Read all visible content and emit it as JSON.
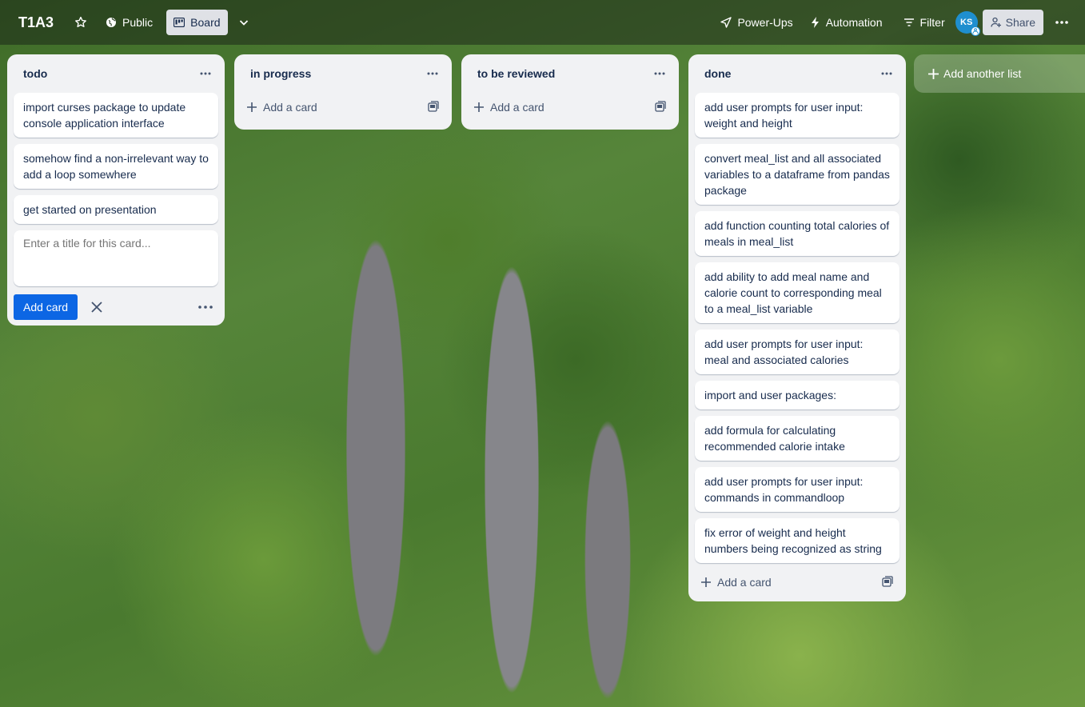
{
  "header": {
    "board_title": "T1A3",
    "visibility_label": "Public",
    "view_label": "Board",
    "powerups_label": "Power-Ups",
    "automation_label": "Automation",
    "filter_label": "Filter",
    "avatar_initials": "KS",
    "share_label": "Share"
  },
  "lists": [
    {
      "title": "todo",
      "cards": [
        "import curses package to update console application interface",
        "somehow find a non-irrelevant way to add a loop somewhere",
        "get started on presentation"
      ],
      "composer_placeholder": "Enter a title for this card...",
      "composer_button": "Add card"
    },
    {
      "title": "in progress",
      "cards": [],
      "add_card_label": "Add a card"
    },
    {
      "title": "to be reviewed",
      "cards": [],
      "add_card_label": "Add a card"
    },
    {
      "title": "done",
      "cards": [
        "add user prompts for user input: weight and height",
        "convert meal_list and all associated variables to a dataframe from pandas package",
        "add function counting total calories of meals in meal_list",
        "add ability to add meal name and calorie count to corresponding meal to a meal_list variable",
        "add user prompts for user input: meal and associated calories",
        "import and user packages:",
        "add formula for calculating recommended calorie intake",
        "add user prompts for user input: commands in commandloop",
        "fix error of weight and height numbers being recognized as string"
      ],
      "add_card_label": "Add a card"
    }
  ],
  "add_list_label": "Add another list",
  "colors": {
    "accent": "#0c66e4",
    "list_bg": "#f1f2f4",
    "text": "#172b4d",
    "avatar": "#1f8fcf"
  }
}
